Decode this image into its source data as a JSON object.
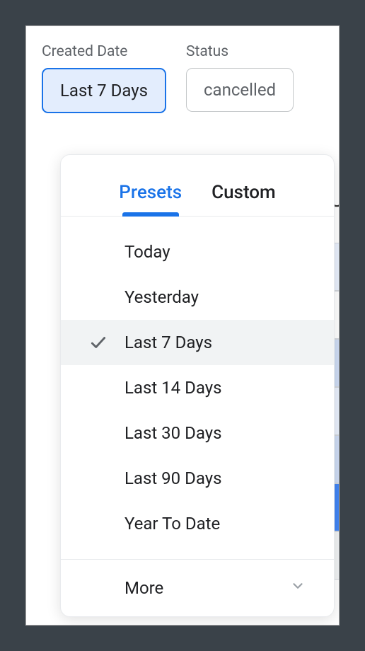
{
  "filters": {
    "createdDate": {
      "label": "Created Date",
      "value": "Last 7 Days"
    },
    "status": {
      "label": "Status",
      "value": "cancelled"
    }
  },
  "dropdown": {
    "tabs": {
      "presets": "Presets",
      "custom": "Custom"
    },
    "presets": [
      {
        "label": "Today",
        "selected": false
      },
      {
        "label": "Yesterday",
        "selected": false
      },
      {
        "label": "Last 7 Days",
        "selected": true
      },
      {
        "label": "Last 14 Days",
        "selected": false
      },
      {
        "label": "Last 30 Days",
        "selected": false
      },
      {
        "label": "Last 90 Days",
        "selected": false
      },
      {
        "label": "Year To Date",
        "selected": false
      }
    ],
    "more": "More"
  }
}
